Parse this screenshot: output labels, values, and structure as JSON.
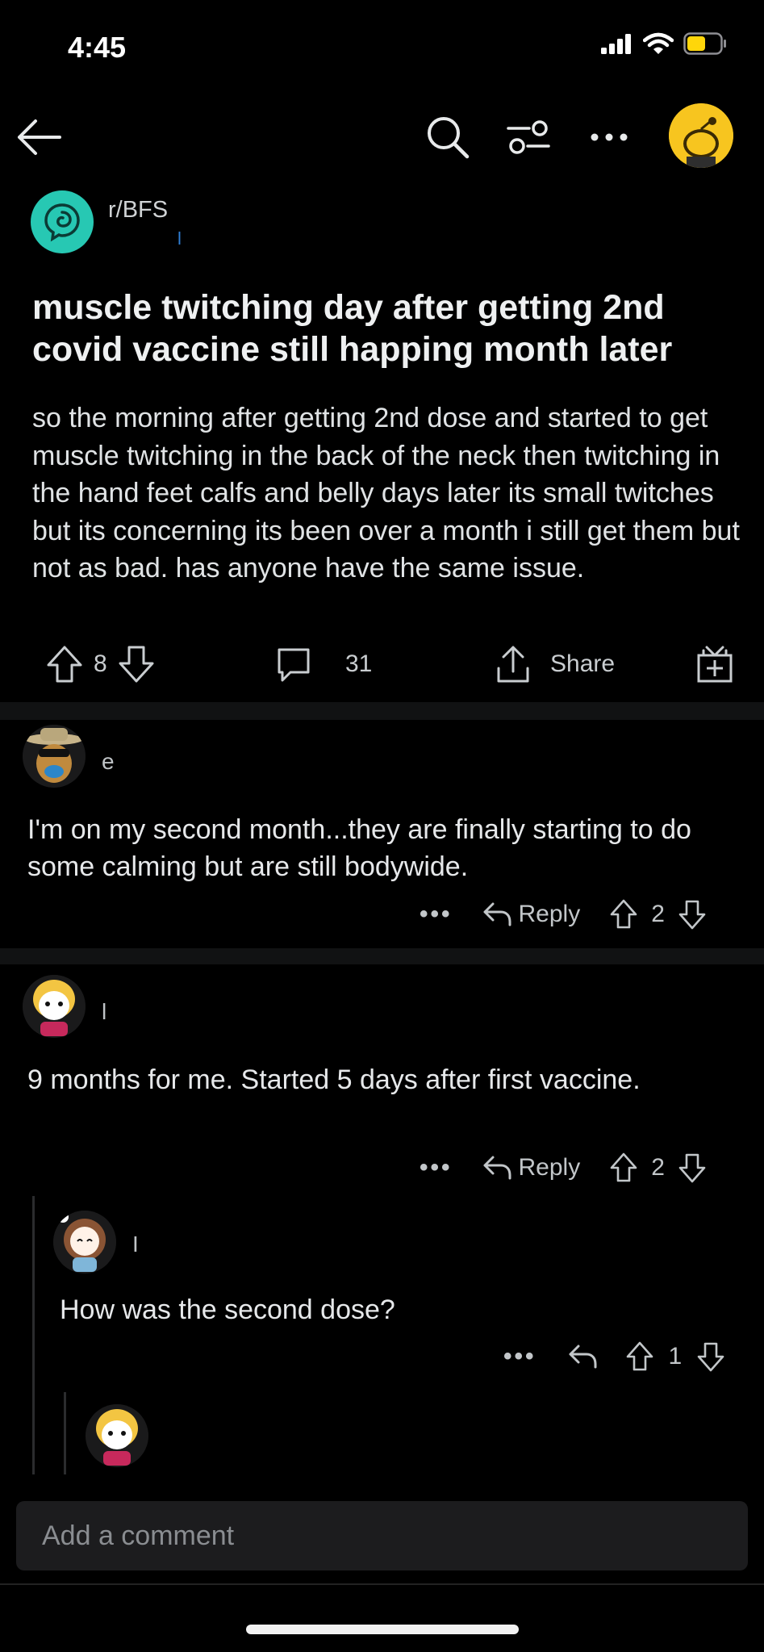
{
  "status_bar": {
    "time": "4:45"
  },
  "subreddit": {
    "name": "r/BFS",
    "user_initial": "l"
  },
  "post": {
    "title": "muscle twitching day after getting 2nd covid vaccine still happing month later",
    "body": "so the morning after getting 2nd dose and started to get muscle twitching in the back of the neck then twitching in the hand feet calfs and belly days later its small twitches but its concerning  its been over a month i still get them but not as bad. has anyone have the same issue.",
    "votes": "8",
    "comments": "31",
    "share_label": "Share"
  },
  "comments": [
    {
      "user": "e",
      "text": "I'm on my second month...they are finally starting to do some calming but are still bodywide.",
      "reply_label": "Reply",
      "votes": "2"
    },
    {
      "user": "l",
      "text": "9 months for me. Started 5 days after first vaccine.",
      "reply_label": "Reply",
      "votes": "2"
    },
    {
      "user": "I",
      "text": "How was the second dose?",
      "votes": "1"
    }
  ],
  "compose": {
    "placeholder": "Add a comment"
  },
  "colors": {
    "background": "#000000",
    "subreddit_icon": "#27c8b3",
    "user_avatar": "#f7c51f"
  }
}
